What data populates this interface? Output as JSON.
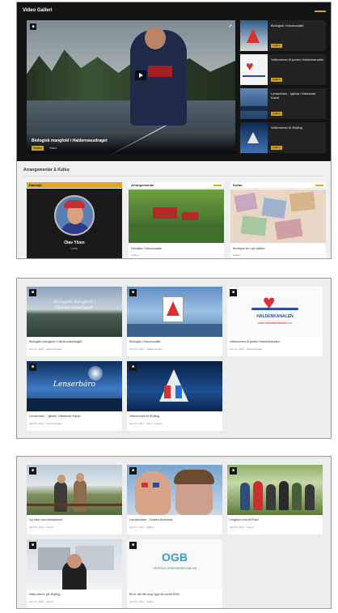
{
  "panel1": {
    "title": "Video Galleri",
    "main_video": {
      "badge": "■",
      "caption": "Biologisk mangfold i Haldenvassdraget",
      "tag": "Halden",
      "meta": "Video"
    },
    "side_items": [
      {
        "title": "Biologisk i fotomosaikk",
        "tag": "Halden"
      },
      {
        "title": "Velkommen til porten Haldenkanalen",
        "tag": "Halden"
      },
      {
        "title": "Lenserbáro - hjärtat i Gästande Kanal",
        "tag": "Halden"
      },
      {
        "title": "Velkommen til Ærjång",
        "tag": "Halden"
      }
    ],
    "section_title": "Arrangementer & Kultur",
    "cards": [
      {
        "head": "Daminje",
        "name": "Olav Ylven",
        "role": "Leder"
      },
      {
        "head": "Arrangementer",
        "title": "Dendijen i fotomosaikk",
        "meta": "Halden"
      },
      {
        "head": "Kultur",
        "title": "Boutique for nye widtke",
        "meta": "Halden"
      }
    ]
  },
  "panel2": {
    "tiles": [
      {
        "badge": "■",
        "cover": "Biologisk mangfold i Haldenvassdraget",
        "title": "Biologisk mangfold i Haldenvassdraget",
        "meta": "april 30, 2014 · Haldenkanalen"
      },
      {
        "badge": "■",
        "cover": "",
        "title": "Biologisk i fotomosaikk",
        "meta": "april 30, 2014 · Haldenkanalen"
      },
      {
        "badge": "■",
        "cover": "HALDENKANALEN",
        "cover_sub": "www.visithaldenkanalen.no",
        "title": "Velkommen til porten Haldenkanalen",
        "meta": "april 30, 2014 · Haldenkanalen"
      },
      {
        "badge": "■",
        "cover": "Lenserbáro",
        "title": "Lenserbáro - hjärtat i Gästande Kanal",
        "meta": "april 30, 2014 · Haldenkanalen"
      },
      {
        "badge": "■",
        "cover": "",
        "title": "Velkommen til Ærjång",
        "meta": "april 30, 2014 · Video · Halden"
      }
    ]
  },
  "panel3": {
    "tiles": [
      {
        "badge": "■",
        "title": "Op etter som kompisene",
        "meta": "april 30, 2014 · Halden"
      },
      {
        "badge": "■",
        "title": "Landsbesker - Kirsten Arrenhka",
        "meta": "april 30, 2014 · Halden"
      },
      {
        "badge": "■",
        "title": "Ungdom drar til Erkel",
        "meta": "april 30, 2014 · Halden"
      },
      {
        "badge": "■",
        "title": "Viste seiner på Ærjång",
        "meta": "april 30, 2014 · Halden"
      },
      {
        "badge": "■",
        "cover": "OGB",
        "cover_sub": "OSTFOLD GREENERIES BUS AS",
        "title": "Bli er det lite brop lyge till norde BSB",
        "meta": "april 30, 2014 · Halden"
      }
    ]
  },
  "colors": {
    "accent": "#e5a61e",
    "dark": "#141414"
  }
}
